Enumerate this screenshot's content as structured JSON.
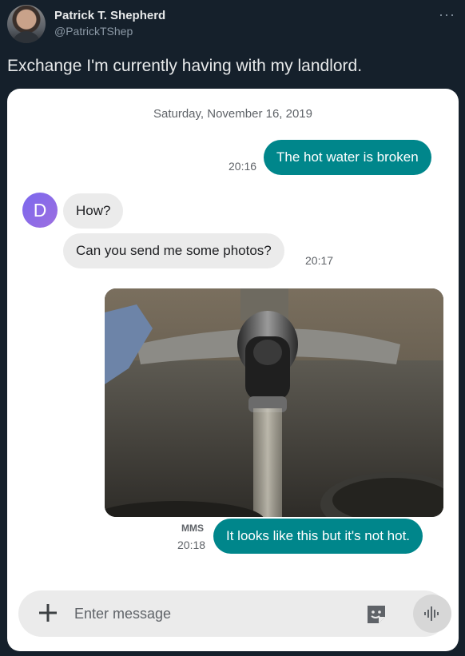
{
  "tweet": {
    "author_name": "Patrick T. Shepherd",
    "author_handle": "@PatrickTShep",
    "more_label": "···",
    "text": "Exchange I'm currently having with my landlord."
  },
  "conversation": {
    "date": "Saturday, November 16, 2019",
    "contact_initial": "D",
    "messages": [
      {
        "direction": "outgoing",
        "text": "The hot water is broken",
        "time": "20:16"
      },
      {
        "direction": "incoming",
        "text": "How?"
      },
      {
        "direction": "incoming",
        "text": "Can you send me some photos?",
        "time": "20:17"
      },
      {
        "direction": "outgoing",
        "type": "image",
        "image_subject": "running faucet over a steel sink"
      },
      {
        "direction": "outgoing",
        "text": "It looks like this but it's not hot.",
        "time": "20:18",
        "tag": "MMS"
      }
    ]
  },
  "composer": {
    "placeholder": "Enter message",
    "add_icon": "plus-icon",
    "sticker_icon": "sticker-icon",
    "voice_icon": "voice-wave-icon"
  },
  "colors": {
    "background": "#15202b",
    "outgoing_bubble": "#00868b",
    "incoming_bubble": "#ebebeb",
    "contact_avatar": "#7b68ee"
  }
}
